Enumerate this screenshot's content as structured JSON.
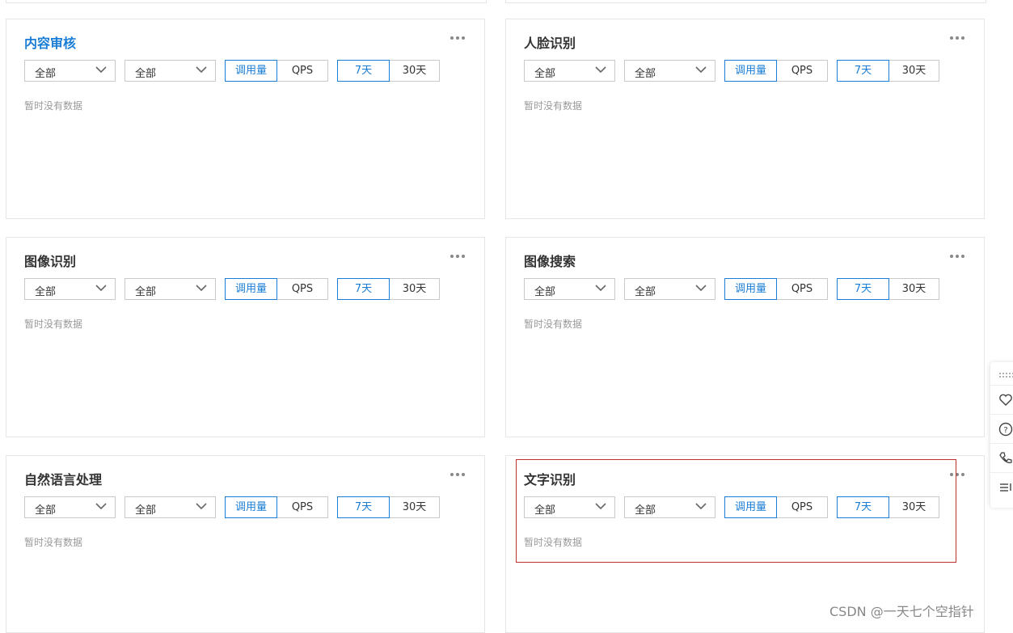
{
  "cards": [
    {
      "title": "内容审核",
      "active": true,
      "select1": "全部",
      "select2": "全部",
      "metric_a": "调用量",
      "metric_b": "QPS",
      "range_a": "7天",
      "range_b": "30天",
      "empty_text": "暂时没有数据"
    },
    {
      "title": "人脸识别",
      "active": false,
      "select1": "全部",
      "select2": "全部",
      "metric_a": "调用量",
      "metric_b": "QPS",
      "range_a": "7天",
      "range_b": "30天",
      "empty_text": "暂时没有数据"
    },
    {
      "title": "图像识别",
      "active": false,
      "select1": "全部",
      "select2": "全部",
      "metric_a": "调用量",
      "metric_b": "QPS",
      "range_a": "7天",
      "range_b": "30天",
      "empty_text": "暂时没有数据"
    },
    {
      "title": "图像搜索",
      "active": false,
      "select1": "全部",
      "select2": "全部",
      "metric_a": "调用量",
      "metric_b": "QPS",
      "range_a": "7天",
      "range_b": "30天",
      "empty_text": "暂时没有数据"
    },
    {
      "title": "自然语言处理",
      "active": false,
      "select1": "全部",
      "select2": "全部",
      "metric_a": "调用量",
      "metric_b": "QPS",
      "range_a": "7天",
      "range_b": "30天",
      "empty_text": "暂时没有数据"
    },
    {
      "title": "文字识别",
      "active": false,
      "select1": "全部",
      "select2": "全部",
      "metric_a": "调用量",
      "metric_b": "QPS",
      "range_a": "7天",
      "range_b": "30天",
      "empty_text": "暂时没有数据"
    }
  ],
  "selected_metric": "调用量",
  "selected_range": "7天",
  "watermark": "CSDN @一天七个空指针",
  "colors": {
    "accent": "#1a7dd6",
    "highlight": "#c0302f",
    "muted": "#999999",
    "border": "#e6e6e6"
  },
  "toolbar_icons": [
    "drag-handle-icon",
    "heart-icon",
    "help-icon",
    "phone-icon",
    "list-icon"
  ]
}
